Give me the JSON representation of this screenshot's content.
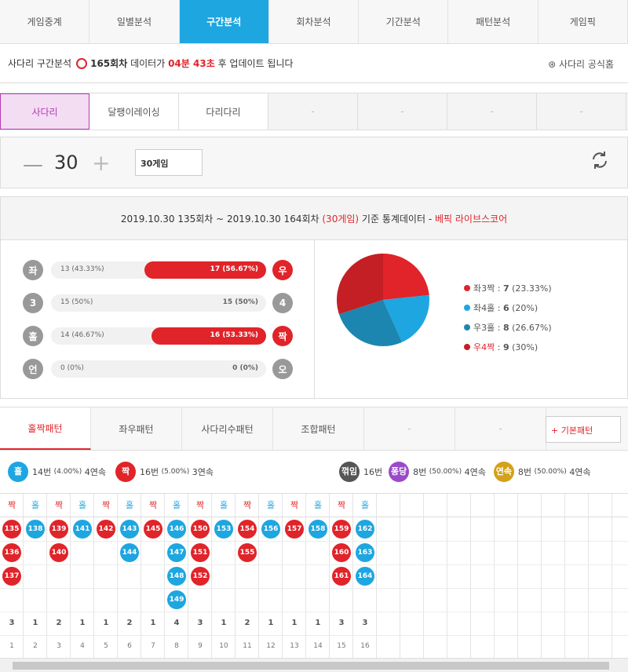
{
  "tabs": [
    "게임중계",
    "일별분석",
    "구간분석",
    "회차분석",
    "기간분석",
    "패턴분석",
    "게임픽"
  ],
  "info": {
    "label": "사다리 구간분석",
    "round": "165회차",
    "mid": "데이터가",
    "time": "04분 43초",
    "tail": "후 업데이트 됩니다",
    "official": "사다리 공식홈"
  },
  "subtabs": [
    "사다리",
    "달팽이레이싱",
    "다리다리",
    "-",
    "-",
    "-",
    "-"
  ],
  "control": {
    "count": "30",
    "select": "30게임"
  },
  "stats": {
    "head_a": "2019.10.30 135회차 ~ 2019.10.30 164회차",
    "head_b": "(30게임)",
    "head_c": "기준 통계데이터 -",
    "head_d": "베픽 라이브스코어",
    "rows": [
      {
        "l": "좌",
        "r": "우",
        "lt": "13 (43.33%)",
        "rt": "17 (56.67%)",
        "pct": 56.67
      },
      {
        "l": "3",
        "r": "4",
        "lt": "15 (50%)",
        "rt": "15 (50%)",
        "pct": 0
      },
      {
        "l": "홀",
        "r": "짝",
        "lt": "14 (46.67%)",
        "rt": "16 (53.33%)",
        "pct": 53.33
      },
      {
        "l": "언",
        "r": "오",
        "lt": "0 (0%)",
        "rt": "0 (0%)",
        "pct": 0
      }
    ]
  },
  "chart_data": {
    "type": "pie",
    "slices": [
      {
        "label": "좌3짝",
        "value": "7",
        "pct": "(23.33%)",
        "color": "#e0242a"
      },
      {
        "label": "좌4홀",
        "value": "6",
        "pct": "(20%)",
        "color": "#1ea6e0"
      },
      {
        "label": "우3홀",
        "value": "8",
        "pct": "(26.67%)",
        "color": "#1d86b0"
      },
      {
        "label": "우4짝",
        "value": "9",
        "pct": "(30%)",
        "color": "#c41f25"
      }
    ]
  },
  "ptabs": [
    "홀짝패턴",
    "좌우패턴",
    "사다리수패턴",
    "조합패턴",
    "-",
    "-"
  ],
  "basic": "+ 기본패턴",
  "summary": {
    "odd": "홀",
    "odd_t": "14번",
    "odd_p": "(4.00%)",
    "odd_s": "4연속",
    "even": "짝",
    "even_t": "16번",
    "even_p": "(5.00%)",
    "even_s": "3연속",
    "kk": "꺾임",
    "kk_t": "16번",
    "pd": "퐁당",
    "pd_t": "8번",
    "pd_p": "(50.00%)",
    "pd_s": "4연속",
    "ys": "연속",
    "ys_t": "8번",
    "ys_p": "(50.00%)",
    "ys_s": "4연속"
  },
  "columns": [
    {
      "h": "짝",
      "n": [
        "135",
        "136",
        "137"
      ]
    },
    {
      "h": "홀",
      "n": [
        "138"
      ]
    },
    {
      "h": "짝",
      "n": [
        "139",
        "140"
      ]
    },
    {
      "h": "홀",
      "n": [
        "141"
      ]
    },
    {
      "h": "짝",
      "n": [
        "142"
      ]
    },
    {
      "h": "홀",
      "n": [
        "143",
        "144"
      ]
    },
    {
      "h": "짝",
      "n": [
        "145"
      ]
    },
    {
      "h": "홀",
      "n": [
        "146",
        "147",
        "148",
        "149"
      ]
    },
    {
      "h": "짝",
      "n": [
        "150",
        "151",
        "152"
      ]
    },
    {
      "h": "홀",
      "n": [
        "153"
      ]
    },
    {
      "h": "짝",
      "n": [
        "154",
        "155"
      ]
    },
    {
      "h": "홀",
      "n": [
        "156"
      ]
    },
    {
      "h": "짝",
      "n": [
        "157"
      ]
    },
    {
      "h": "홀",
      "n": [
        "158"
      ]
    },
    {
      "h": "짝",
      "n": [
        "159",
        "160",
        "161"
      ]
    },
    {
      "h": "홀",
      "n": [
        "162",
        "163",
        "164"
      ]
    }
  ],
  "counts": [
    "3",
    "1",
    "2",
    "1",
    "1",
    "2",
    "1",
    "4",
    "3",
    "1",
    "2",
    "1",
    "1",
    "1",
    "3",
    "3"
  ],
  "idx": [
    "1",
    "2",
    "3",
    "4",
    "5",
    "6",
    "7",
    "8",
    "9",
    "10",
    "11",
    "12",
    "13",
    "14",
    "15",
    "16"
  ]
}
